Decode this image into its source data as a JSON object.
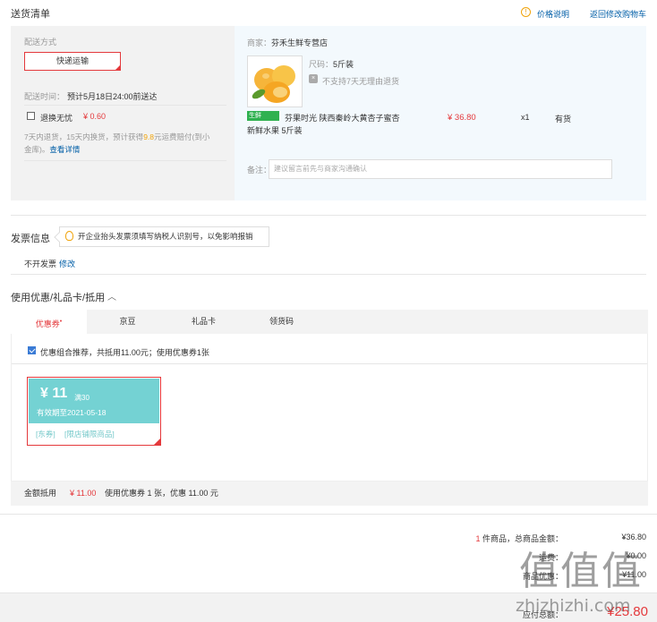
{
  "header": {
    "title": "送货清单",
    "price_note": "价格说明",
    "back_link": "返回修改购物车"
  },
  "shipping": {
    "method_label": "配送方式",
    "method_value": "快递运输",
    "time_label": "配送时间：",
    "time_value": "预计5月18日24:00前送达",
    "worry_free_label": "退换无忧",
    "worry_free_price": "¥ 0.60",
    "worry_free_desc_1": "7天内退货，15天内换货，预计获得",
    "worry_free_amount": "9.8",
    "worry_free_desc_2": "元运费赔付(到小",
    "worry_free_desc_3": "金库)。",
    "detail_link": "查看详情"
  },
  "order": {
    "merchant_label": "商家：",
    "merchant_name": "芬禾生鲜专营店",
    "size_label": "尺码：",
    "size_value": "5斤装",
    "return_policy": "不支持7天无理由退货",
    "badge": "生鲜",
    "product_name_1": "芬果时光 陕西秦岭大黄杏子蜜杏",
    "product_name_2": "新鲜水果 5斤装",
    "price": "¥ 36.80",
    "qty": "x1",
    "stock": "有货",
    "memo_label": "备注：",
    "memo_placeholder": "建议留言前先与商家沟通确认"
  },
  "invoice": {
    "title": "发票信息",
    "tip": "开企业抬头发票须填写纳税人识别号，以免影响报销",
    "value": "不开发票",
    "edit": "修改"
  },
  "coupon": {
    "title": "使用优惠/礼品卡/抵用",
    "tabs": [
      "优惠券",
      "京豆",
      "礼品卡",
      "领货码"
    ],
    "recommend": "优惠组合推荐，共抵用11.00元；使用优惠券1张",
    "amount": "¥ 11",
    "condition": "满30",
    "validity": "有效期至2021-05-18",
    "type_tag": "[东券]",
    "scope_tag": "[限店铺限商品]",
    "sum_label": "金额抵用",
    "sum_value": "¥ 11.00",
    "sum_desc": "使用优惠券 1 张，优惠 11.00 元"
  },
  "totals": {
    "count": "1",
    "count_label": "件商品，总商品金额：",
    "goods_total": "¥36.80",
    "row2_label": "运费：",
    "row2_value": "¥0.00",
    "row3_label": "商品优惠：",
    "row3_value": "-¥11.00",
    "payable_label": "应付总额：",
    "payable_value": "¥25.80"
  },
  "watermark": {
    "logo": "值值值",
    "url": "zhizhizhi.com"
  },
  "colors": {
    "accent": "#e4393c",
    "link": "#005ea7",
    "coupon": "#74d2d3",
    "fresh": "#2fb150"
  }
}
